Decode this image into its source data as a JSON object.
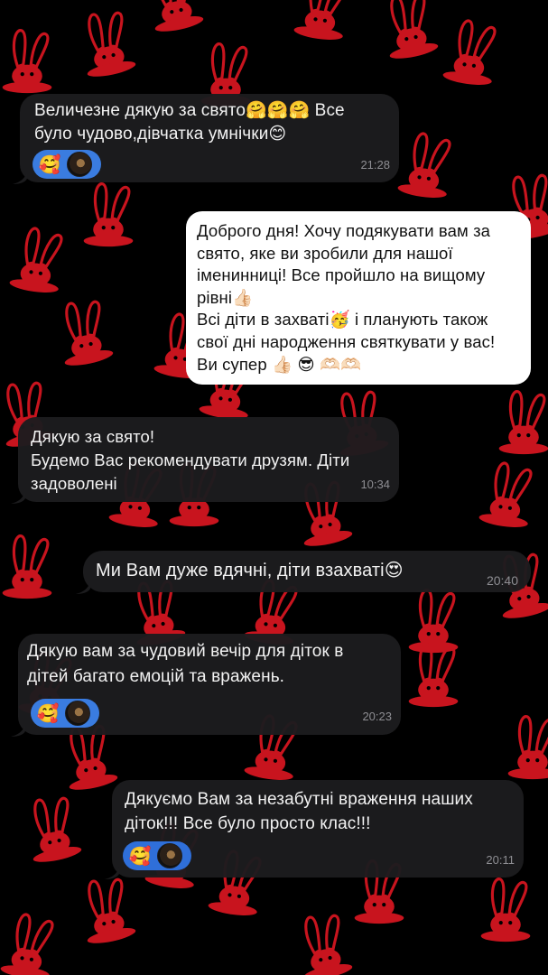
{
  "messages": [
    {
      "id": "m1",
      "side": "left",
      "text": "Величезне дякую за свято🤗🤗🤗 Все було чудово,дівчатка умнічки😊",
      "time": "21:28",
      "reactions": [
        "🥰"
      ]
    },
    {
      "id": "m2",
      "side": "right-white",
      "text": "Доброго дня! Хочу подякувати вам за свято, яке ви зробили для нашої іменинниці! Все пройшло на вищому рівні👍🏻\nВсі діти в захваті🥳 і планують також свої дні народження святкувати у вас!\nВи супер 👍🏻 😎 🫶🏻🫶🏻",
      "time": "",
      "reactions": []
    },
    {
      "id": "m3",
      "side": "left",
      "text": "Дякую за свято!\nБудемо Вас рекомендувати друзям. Діти задоволені",
      "time": "10:34",
      "reactions": []
    },
    {
      "id": "m4",
      "side": "right",
      "text": "Ми Вам дуже вдячні, діти взахваті😍",
      "time": "20:40",
      "reactions": []
    },
    {
      "id": "m5",
      "side": "left",
      "text": "Дякую вам за чудовий вечір для діток в дітей багато емоцій та вражень.",
      "time": "20:23",
      "reactions": [
        "🥰"
      ]
    },
    {
      "id": "m6",
      "side": "right",
      "text": "Дякуємо Вам за незабутні враження наших діток!!! Все було просто клас!!!",
      "time": "20:11",
      "reactions": [
        "🥰"
      ]
    }
  ],
  "colors": {
    "background": "#000000",
    "pattern": "#c8141e",
    "bubble_dark": "#1c1c1e",
    "bubble_light": "#ffffff",
    "reaction_pill": "#3a7ce0",
    "time_text": "#8e8e93"
  },
  "icons": {
    "background_pattern": "rabbit-ears-hat-icon",
    "reaction_avatar": "avatar"
  }
}
